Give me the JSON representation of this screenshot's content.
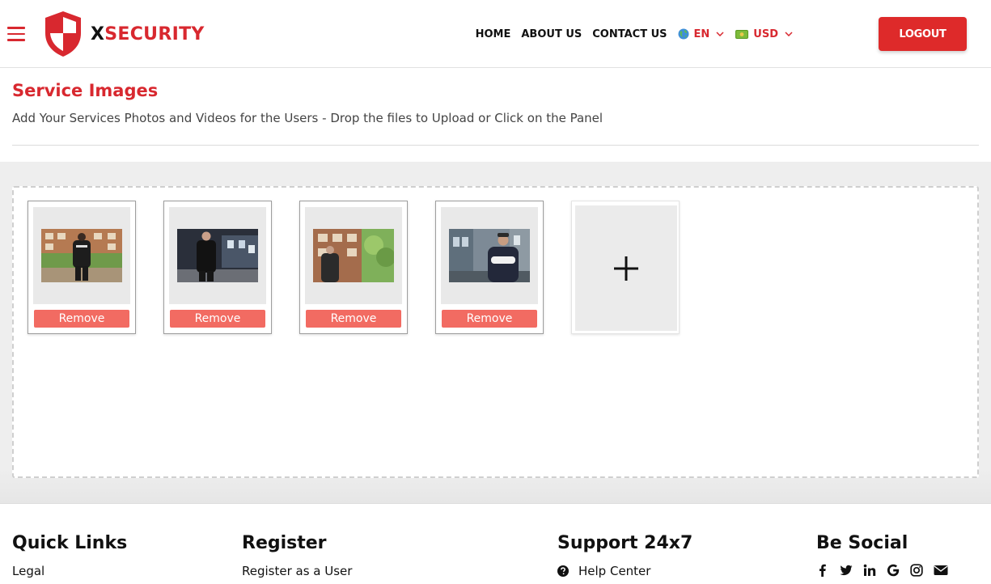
{
  "header": {
    "logo": {
      "x_letter": "X",
      "rest": "SECURITY"
    },
    "nav": [
      {
        "label": "HOME"
      },
      {
        "label": "ABOUT US"
      },
      {
        "label": "CONTACT US"
      }
    ],
    "language": {
      "value": "EN",
      "icon": "globe-icon"
    },
    "currency": {
      "value": "USD",
      "icon": "cash-icon"
    },
    "logout_label": "LOGOUT",
    "accent_color": "#d8282f"
  },
  "page": {
    "title": "Service Images",
    "subtitle": "Add Your Services Photos and Videos for the Users - Drop the files to Upload or Click on the Panel"
  },
  "uploads": {
    "items": [
      {
        "remove_label": "Remove",
        "image": "security guard walking in park"
      },
      {
        "remove_label": "Remove",
        "image": "security guard standing at night"
      },
      {
        "remove_label": "Remove",
        "image": "security guard with radio near building"
      },
      {
        "remove_label": "Remove",
        "image": "security guard with crossed arms on street"
      }
    ],
    "add_icon": "plus-icon",
    "remove_color": "#f26b62"
  },
  "footer": {
    "quick_links": {
      "heading": "Quick Links",
      "links": [
        "Legal"
      ]
    },
    "register": {
      "heading": "Register",
      "links": [
        "Register as a User"
      ]
    },
    "support": {
      "heading": "Support 24x7",
      "links": [
        "Help Center"
      ]
    },
    "social": {
      "heading": "Be Social",
      "icons": [
        "facebook-icon",
        "twitter-icon",
        "linkedin-icon",
        "google-icon",
        "instagram-icon",
        "email-icon"
      ]
    }
  }
}
